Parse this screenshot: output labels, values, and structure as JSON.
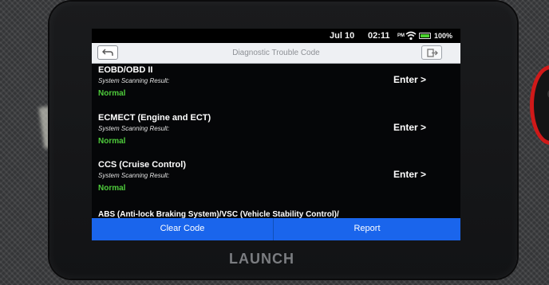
{
  "status_bar": {
    "date": "Jul 10",
    "time": "02:11",
    "ampm": "PM",
    "battery": "100%",
    "battery_fraction": 1.0
  },
  "title_bar": {
    "title": "Diagnostic Trouble Code",
    "back_icon": "back-arrow-icon",
    "exit_icon": "exit-icon"
  },
  "modules": [
    {
      "name": "EOBD/OBD II",
      "scan_label": "System Scanning Result:",
      "result": "Normal",
      "action": "Enter >"
    },
    {
      "name": "ECMECT (Engine and ECT)",
      "scan_label": "System Scanning Result:",
      "result": "Normal",
      "action": "Enter >"
    },
    {
      "name": "CCS (Cruise Control)",
      "scan_label": "System Scanning Result:",
      "result": "Normal",
      "action": "Enter >"
    },
    {
      "name": "ABS (Anti-lock Braking System)/VSC (Vehicle Stability Control)/"
    }
  ],
  "bottom_bar": {
    "clear_label": "Clear Code",
    "report_label": "Report"
  },
  "device": {
    "brand": "LAUNCH",
    "accent_color": "#d01919"
  },
  "colors": {
    "result_green": "#4ecb3b",
    "button_blue": "#1a65ec",
    "battery_green": "#4cd230"
  }
}
